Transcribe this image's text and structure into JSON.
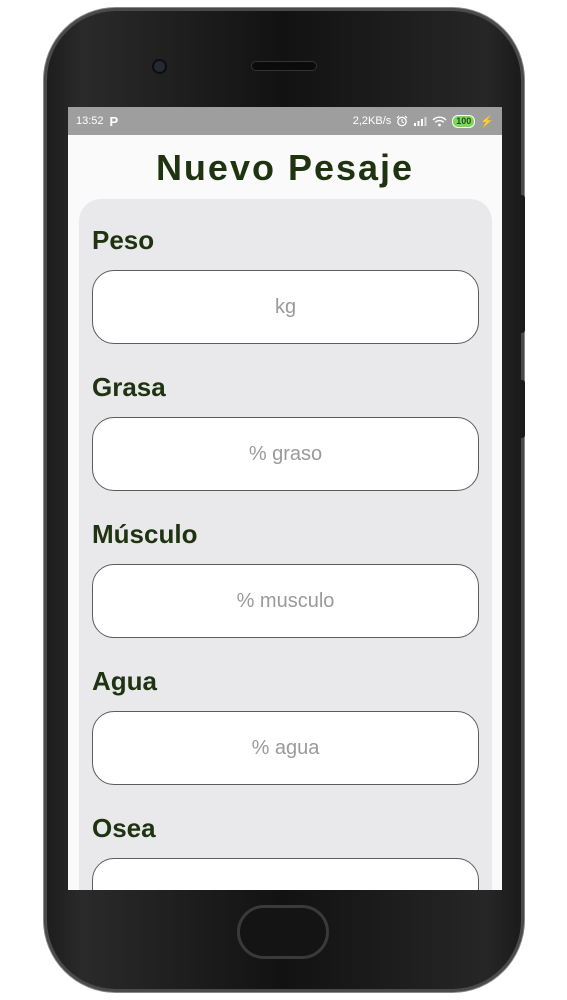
{
  "status_bar": {
    "time": "13:52",
    "notification_icon": "P",
    "speed": "2,2KB/s",
    "battery": "100"
  },
  "page": {
    "title": "Nuevo Pesaje"
  },
  "fields": [
    {
      "label": "Peso",
      "placeholder": "kg"
    },
    {
      "label": "Grasa",
      "placeholder": "% graso"
    },
    {
      "label": "Músculo",
      "placeholder": "% musculo"
    },
    {
      "label": "Agua",
      "placeholder": "% agua"
    },
    {
      "label": "Osea",
      "placeholder": ""
    }
  ]
}
